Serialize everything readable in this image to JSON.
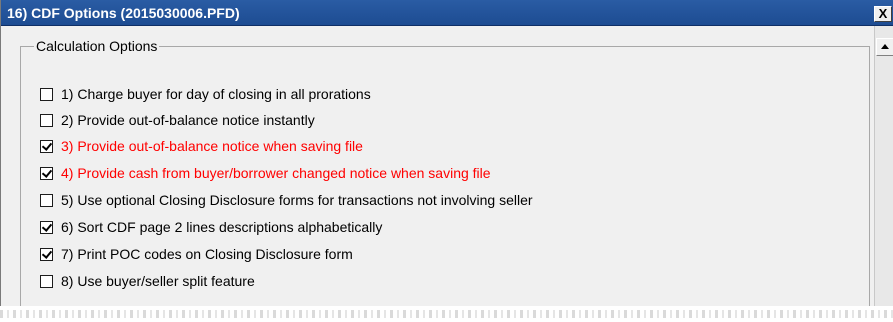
{
  "window": {
    "title": "16) CDF Options (2015030006.PFD)",
    "close_label": "X"
  },
  "calculation_options": {
    "legend": "Calculation Options",
    "items": [
      {
        "label": "1) Charge buyer for day of closing in all prorations",
        "checked": false,
        "highlight": false
      },
      {
        "label": "2) Provide out-of-balance notice instantly",
        "checked": false,
        "highlight": false
      },
      {
        "label": "3) Provide out-of-balance notice when saving file",
        "checked": true,
        "highlight": true
      },
      {
        "label": "4) Provide cash from buyer/borrower changed notice when saving file",
        "checked": true,
        "highlight": true
      },
      {
        "label": "5) Use optional Closing Disclosure forms for transactions not involving seller",
        "checked": false,
        "highlight": false
      },
      {
        "label": "6) Sort CDF page 2 lines descriptions alphabetically",
        "checked": true,
        "highlight": false
      },
      {
        "label": "7) Print POC codes on Closing Disclosure form",
        "checked": true,
        "highlight": false
      },
      {
        "label": "8) Use buyer/seller split feature",
        "checked": false,
        "highlight": false
      }
    ]
  },
  "colors": {
    "titlebar": "#1d4c92",
    "highlight_text": "#ff0000",
    "dialog_bg": "#f0f0f0"
  },
  "icons": {
    "close": "close-icon",
    "scroll_up": "scroll-up-arrow-icon",
    "check": "checkmark-icon"
  }
}
